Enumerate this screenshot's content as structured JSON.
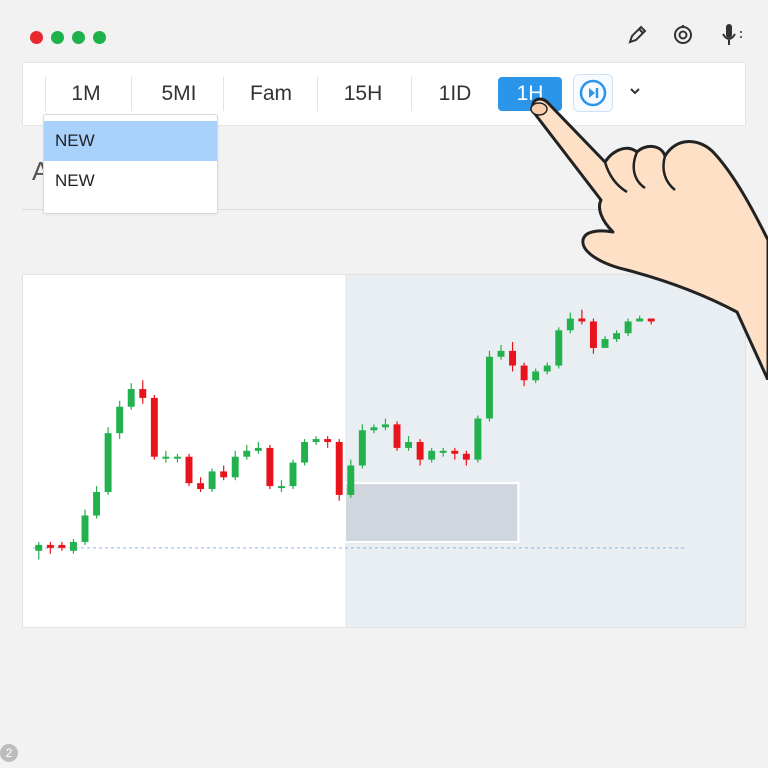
{
  "window": {
    "traffic_lights": [
      "#e8262d",
      "#1fb14a",
      "#1fb14a",
      "#1fb14a"
    ],
    "icons": [
      "edit-icon",
      "settings-icon",
      "microphone-icon"
    ]
  },
  "toolbar": {
    "timeframes": [
      {
        "label": "1M"
      },
      {
        "label": "5MI"
      },
      {
        "label": "Fam"
      },
      {
        "label": "15H"
      },
      {
        "label": "1ID"
      },
      {
        "label": "1H"
      }
    ],
    "active_index": 5,
    "extra_icon": "replay-icon",
    "menu_icon": "chevron-down-icon",
    "accent_color": "#2b95ea"
  },
  "dropdown": {
    "items": [
      {
        "label": "NEW",
        "selected": true
      },
      {
        "label": "NEW",
        "selected": false
      }
    ]
  },
  "heading": {
    "text": "A"
  },
  "chart": {
    "up_color": "#22b14c",
    "down_color": "#e8131b",
    "highlight_color": "#e8eef1",
    "selection_color": "#cfd6de",
    "baseline_color": "#8ab4f0"
  },
  "chart_data": {
    "type": "candlestick",
    "title": "",
    "xlabel": "",
    "ylabel": "",
    "ylim": [
      0,
      100
    ],
    "grid": false,
    "series": [
      {
        "values": [
          [
            13,
            15,
            16,
            10
          ],
          [
            15,
            14,
            16,
            12
          ],
          [
            15,
            14,
            16,
            13
          ],
          [
            13,
            16,
            17,
            12
          ],
          [
            16,
            25,
            27,
            15
          ],
          [
            25,
            33,
            35,
            24
          ],
          [
            33,
            53,
            55,
            32
          ],
          [
            53,
            62,
            64,
            51
          ],
          [
            62,
            68,
            70,
            61
          ],
          [
            68,
            65,
            71,
            63
          ],
          [
            65,
            45,
            66,
            44
          ],
          [
            45,
            45,
            47,
            43
          ],
          [
            45,
            45,
            46,
            43
          ],
          [
            45,
            36,
            46,
            35
          ],
          [
            36,
            34,
            38,
            33
          ],
          [
            34,
            40,
            41,
            33
          ],
          [
            40,
            38,
            42,
            37
          ],
          [
            38,
            45,
            47,
            37
          ],
          [
            45,
            47,
            49,
            44
          ],
          [
            47,
            48,
            50,
            46
          ],
          [
            48,
            35,
            49,
            34
          ],
          [
            35,
            35,
            37,
            33
          ],
          [
            35,
            43,
            44,
            34
          ],
          [
            43,
            50,
            51,
            42
          ],
          [
            50,
            51,
            52,
            49
          ],
          [
            51,
            50,
            52,
            48
          ],
          [
            50,
            32,
            51,
            30
          ],
          [
            32,
            42,
            44,
            31
          ],
          [
            42,
            54,
            56,
            41
          ],
          [
            54,
            55,
            56,
            53
          ],
          [
            55,
            56,
            58,
            54
          ],
          [
            56,
            48,
            57,
            47
          ],
          [
            48,
            50,
            52,
            47
          ],
          [
            50,
            44,
            51,
            42
          ],
          [
            44,
            47,
            48,
            43
          ],
          [
            47,
            47,
            48,
            45
          ],
          [
            47,
            46,
            48,
            44
          ],
          [
            46,
            44,
            47,
            42
          ],
          [
            44,
            58,
            59,
            43
          ],
          [
            58,
            79,
            81,
            57
          ],
          [
            79,
            81,
            83,
            78
          ],
          [
            81,
            76,
            84,
            74
          ],
          [
            76,
            71,
            77,
            69
          ],
          [
            71,
            74,
            75,
            70
          ],
          [
            74,
            76,
            77,
            73
          ],
          [
            76,
            88,
            89,
            75
          ],
          [
            88,
            92,
            94,
            87
          ],
          [
            92,
            91,
            95,
            90
          ],
          [
            91,
            82,
            92,
            80
          ],
          [
            82,
            85,
            86,
            83
          ],
          [
            85,
            87,
            88,
            84
          ],
          [
            87,
            91,
            92,
            86
          ],
          [
            91,
            92,
            93,
            91
          ],
          [
            92,
            91,
            92,
            90
          ]
        ]
      }
    ],
    "reference_level": 14,
    "highlight_region_start": 27,
    "selection_box": {
      "x_start": 27,
      "x_end": 42,
      "y_low": 16,
      "y_high": 36
    }
  }
}
